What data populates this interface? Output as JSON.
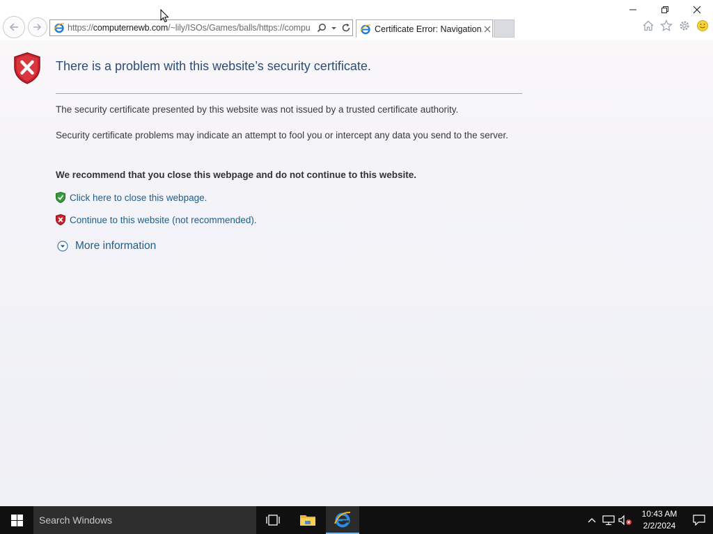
{
  "browser": {
    "address": {
      "prefix": "https://",
      "host": "computernewb.com",
      "path": "/~lily/ISOs/Games/balls/https://compu"
    },
    "tab": {
      "title": "Certificate Error: Navigation..."
    },
    "icons": {
      "back": "back-arrow-icon",
      "forward": "forward-arrow-icon",
      "search": "search-icon",
      "refresh": "refresh-icon",
      "home": "home-icon",
      "favorites": "star-icon",
      "tools": "gear-icon",
      "feedback": "smiley-icon"
    }
  },
  "page": {
    "title": "There is a problem with this website’s security certificate.",
    "para1": "The security certificate presented by this website was not issued by a trusted certificate authority.",
    "para2": "Security certificate problems may indicate an attempt to fool you or intercept any data you send to the server.",
    "recommend": "We recommend that you close this webpage and do not continue to this website.",
    "close_link": "Click here to close this webpage.",
    "continue_link": "Continue to this website (not recommended).",
    "more_info": "More information"
  },
  "taskbar": {
    "search_placeholder": "Search Windows",
    "time": "10:43 AM",
    "date": "2/2/2024"
  },
  "colors": {
    "title_blue": "#2a4d78",
    "link_blue": "#1e5e8a",
    "error_red": "#c8232c",
    "ok_green": "#3b9b3b"
  }
}
